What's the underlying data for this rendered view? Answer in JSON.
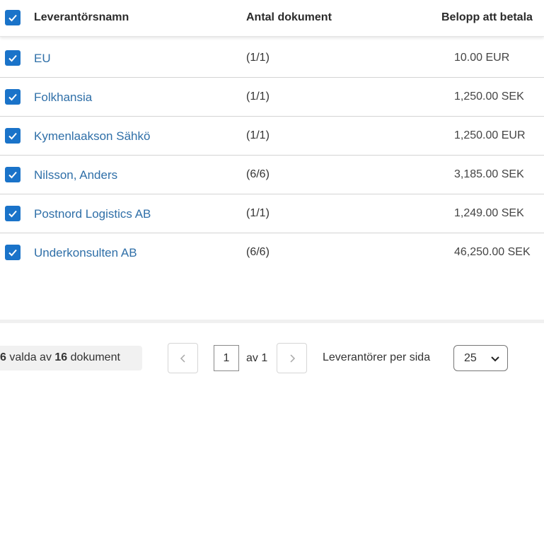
{
  "header": {
    "col_name": "Leverantörsnamn",
    "col_count": "Antal dokument",
    "col_amount": "Belopp att betala"
  },
  "rows": [
    {
      "name": "EU",
      "count": "(1/1)",
      "amount": "10.00 EUR"
    },
    {
      "name": "Folkhansia",
      "count": "(1/1)",
      "amount": "1,250.00 SEK"
    },
    {
      "name": "Kymenlaakson Sähkö",
      "count": "(1/1)",
      "amount": "1,250.00 EUR"
    },
    {
      "name": "Nilsson, Anders",
      "count": "(6/6)",
      "amount": "3,185.00 SEK"
    },
    {
      "name": "Postnord Logistics AB",
      "count": "(1/1)",
      "amount": "1,249.00 SEK"
    },
    {
      "name": "Underkonsulten AB",
      "count": "(6/6)",
      "amount": "46,250.00 SEK"
    }
  ],
  "footer": {
    "selected": "6",
    "selected_text": "valda av",
    "total": "16",
    "total_text": "dokument",
    "page_current": "1",
    "page_of": "av 1",
    "per_page_label": "Leverantörer per sida",
    "per_page_value": "25"
  },
  "colors": {
    "accent": "#1a73c9",
    "link": "#2f6fa8"
  },
  "icons": {
    "checkbox": "checkmark-icon",
    "prev": "chevron-left-icon",
    "next": "chevron-right-icon",
    "select": "chevron-down-icon"
  }
}
